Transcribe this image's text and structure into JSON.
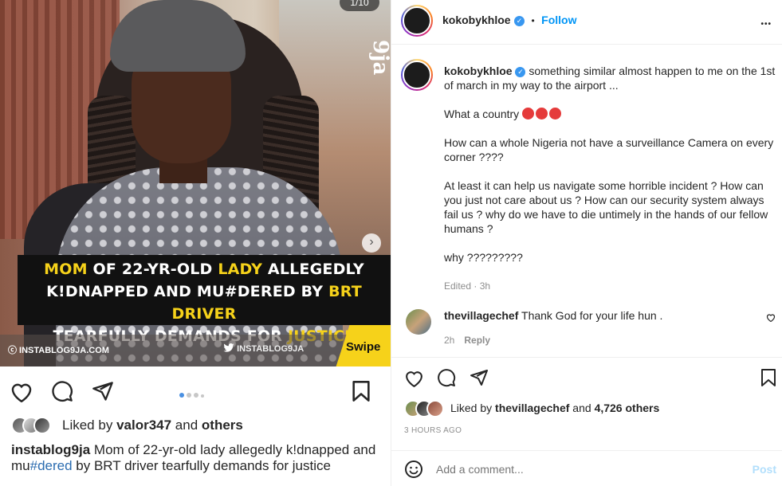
{
  "media": {
    "counter": "1/10",
    "watermark": "9ja",
    "headline": {
      "line1": [
        "MOM",
        " OF 22-YR-OLD ",
        "LADY",
        " ALLEGEDLY"
      ],
      "line2": [
        "K!DNAPPED AND MU#DERED BY ",
        "BRT DRIVER"
      ],
      "line3": [
        "TEARFULLY DEMANDS FOR ",
        "JUSTICE"
      ]
    },
    "brand_left": "ⓒ INSTABLOG9JA.COM",
    "brand_right": "INSTABLOG9JA",
    "swipe": "Swipe"
  },
  "embedded": {
    "liked_by_user": "valor347",
    "liked_and": "Liked by",
    "liked_others": "others",
    "liked_connector": "and",
    "caption_user": "instablog9ja",
    "caption_text_1": " Mom of 22-yr-old lady allegedly k!dnapped and mu",
    "caption_tag": "#dered",
    "caption_text_2": " by BRT driver tearfully demands for justice"
  },
  "header": {
    "username": "kokobykhloe",
    "separator": "•",
    "follow": "Follow",
    "more": "•••"
  },
  "comment": {
    "username": "kokobykhloe",
    "line1": " something similar almost happen to me on the 1st of march in my way to the airport ...",
    "para2": "What a country ",
    "para3": "How can a whole Nigeria not have a surveillance Camera on every corner ????",
    "para4": "At least it can help us navigate some horrible incident ? How can you just not care about us ? How can our security system always fail us ? why do we have to die untimely in the hands of our fellow humans ?",
    "para5": "why ?????????",
    "meta": "Edited · 3h"
  },
  "reply": {
    "username": "thevillagechef",
    "text": " Thank God for your life hun .",
    "time": "2h",
    "reply_label": "Reply"
  },
  "likes": {
    "prefix": "Liked by ",
    "user": "thevillagechef",
    "connector": " and ",
    "count": "4,726 others"
  },
  "time_ago": "3 HOURS AGO",
  "add_comment": {
    "placeholder": "Add a comment...",
    "post": "Post"
  },
  "colors": {
    "accent": "#0095f6",
    "headline_highlight": "#f6d21a",
    "verified": "#3897f0"
  }
}
